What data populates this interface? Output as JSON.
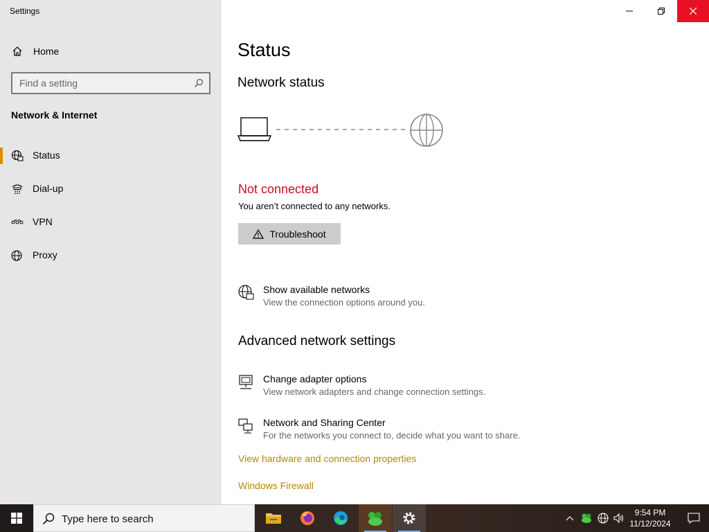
{
  "window": {
    "app_title": "Settings"
  },
  "sidebar": {
    "home_label": "Home",
    "search_placeholder": "Find a setting",
    "section_title": "Network & Internet",
    "items": [
      {
        "label": "Status",
        "icon": "status-globe-icon",
        "active": true
      },
      {
        "label": "Dial-up",
        "icon": "dialup-icon",
        "active": false
      },
      {
        "label": "VPN",
        "icon": "vpn-icon",
        "active": false
      },
      {
        "label": "Proxy",
        "icon": "globe-icon",
        "active": false
      }
    ]
  },
  "main": {
    "title": "Status",
    "network_status_heading": "Network status",
    "status_text": "Not connected",
    "status_desc": "You aren’t connected to any networks.",
    "troubleshoot_label": "Troubleshoot",
    "show_networks": {
      "title": "Show available networks",
      "desc": "View the connection options around you."
    },
    "advanced_heading": "Advanced network settings",
    "adapter_options": {
      "title": "Change adapter options",
      "desc": "View network adapters and change connection settings."
    },
    "sharing_center": {
      "title": "Network and Sharing Center",
      "desc": "For the networks you connect to, decide what you want to share."
    },
    "link_hardware": "View hardware and connection properties",
    "link_firewall": "Windows Firewall"
  },
  "taskbar": {
    "search_placeholder": "Type here to search",
    "apps": [
      "file-explorer-icon",
      "firefox-icon",
      "edge-icon",
      "green-app-icon",
      "settings-gear-icon"
    ],
    "time": "9:54 PM",
    "date": "11/12/2024"
  },
  "colors": {
    "accent": "#d98f00",
    "error": "#c50f1f",
    "link": "#b8860b",
    "close_red": "#e81123"
  }
}
